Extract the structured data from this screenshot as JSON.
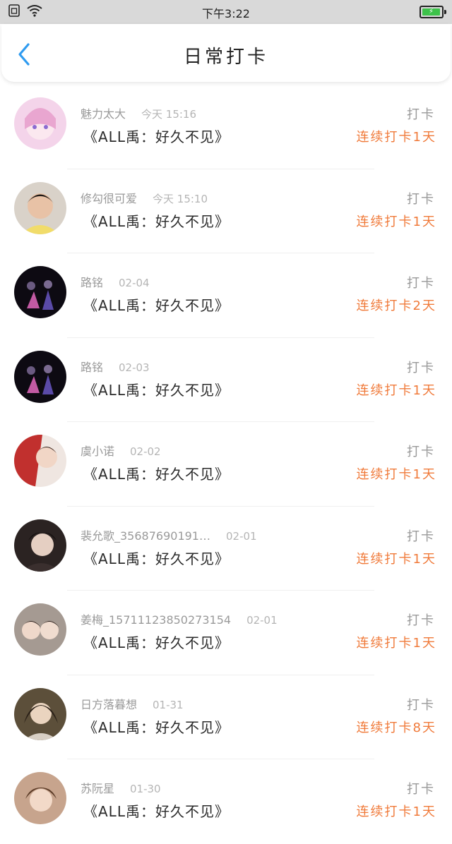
{
  "status_bar": {
    "time": "下午3:22"
  },
  "header": {
    "title": "日常打卡"
  },
  "rows": [
    {
      "name": "魅力太大",
      "time": "今天 15:16",
      "message": "《ALL禹：好久不见》",
      "tag": "打卡",
      "streak": "连续打卡1天",
      "avatar_color": "#f2c6e4"
    },
    {
      "name": "修勾很可爱",
      "time": "今天 15:10",
      "message": "《ALL禹：好久不见》",
      "tag": "打卡",
      "streak": "连续打卡1天",
      "avatar_color": "#f1dc6a"
    },
    {
      "name": "路铭",
      "time": "02-04",
      "message": "《ALL禹：好久不见》",
      "tag": "打卡",
      "streak": "连续打卡2天",
      "avatar_color": "#1a1020"
    },
    {
      "name": "路铭",
      "time": "02-03",
      "message": "《ALL禹：好久不见》",
      "tag": "打卡",
      "streak": "连续打卡1天",
      "avatar_color": "#1a1020"
    },
    {
      "name": "虞小诺",
      "time": "02-02",
      "message": "《ALL禹：好久不见》",
      "tag": "打卡",
      "streak": "连续打卡1天",
      "avatar_color": "#c1302e"
    },
    {
      "name": "裴允歌_35687690191…",
      "time": "02-01",
      "message": "《ALL禹：好久不见》",
      "tag": "打卡",
      "streak": "连续打卡1天",
      "avatar_color": "#3a2f2e"
    },
    {
      "name": "姜梅_15711123850273154",
      "time": "02-01",
      "message": "《ALL禹：好久不见》",
      "tag": "打卡",
      "streak": "连续打卡1天",
      "avatar_color": "#8c7f78"
    },
    {
      "name": "日方落暮想",
      "time": "01-31",
      "message": "《ALL禹：好久不见》",
      "tag": "打卡",
      "streak": "连续打卡8天",
      "avatar_color": "#6b5a3e"
    },
    {
      "name": "苏阮星",
      "time": "01-30",
      "message": "《ALL禹：好久不见》",
      "tag": "打卡",
      "streak": "连续打卡1天",
      "avatar_color": "#b88a6e"
    }
  ],
  "colors": {
    "accent": "#2f9bf0",
    "streak": "#f07a3a",
    "status_bar_bg": "#d9d9d9"
  }
}
